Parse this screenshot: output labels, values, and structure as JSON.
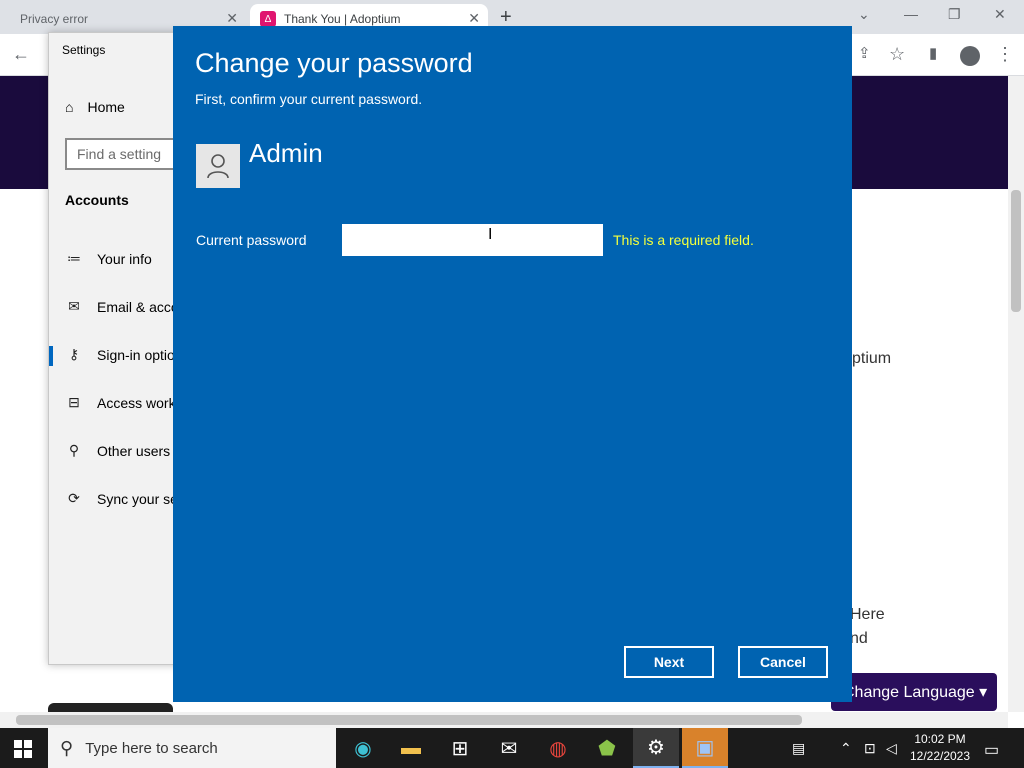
{
  "browser": {
    "tabs": [
      {
        "title": "Privacy error"
      },
      {
        "title": "Thank You | Adoptium"
      }
    ],
    "new_tab": "+"
  },
  "webpage": {
    "text_1": "ptium",
    "text_2": "Here",
    "text_3": "nd",
    "language_button": "Change Language ▾"
  },
  "settings": {
    "window_title": "Settings",
    "home": "Home",
    "search_placeholder": "Find a setting",
    "section": "Accounts",
    "items": [
      {
        "label": "Your info",
        "icon": "person-card-icon"
      },
      {
        "label": "Email & acco",
        "icon": "mail-icon"
      },
      {
        "label": "Sign-in optio",
        "icon": "key-icon"
      },
      {
        "label": "Access work",
        "icon": "briefcase-icon"
      },
      {
        "label": "Other users",
        "icon": "add-person-icon"
      },
      {
        "label": "Sync your se",
        "icon": "sync-icon"
      }
    ]
  },
  "dialog": {
    "title": "Change your password",
    "subtitle": "First, confirm your current password.",
    "user_name": "Admin",
    "password_label": "Current password",
    "password_value": "",
    "error": "This is a required field.",
    "next_button": "Next",
    "cancel_button": "Cancel",
    "background_color": "#0063b1",
    "error_color": "#f3ff3d"
  },
  "taskbar": {
    "search_placeholder": "Type here to search",
    "time": "10:02 PM",
    "date": "12/22/2023"
  }
}
